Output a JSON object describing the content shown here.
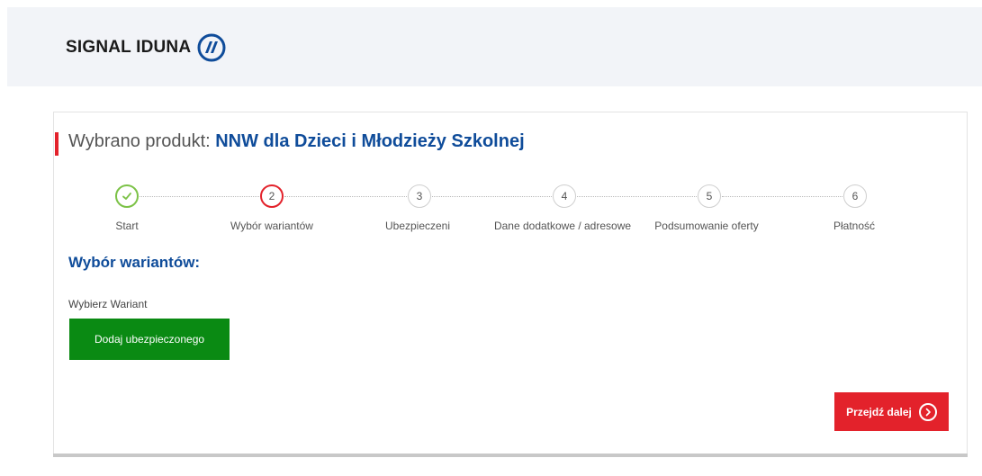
{
  "header": {
    "logo_text": "SIGNAL IDUNA",
    "logo_icon": "signal-iduna-logo-mark",
    "brand_color": "#0f4c9a"
  },
  "title": {
    "prefix": "Wybrano produkt: ",
    "product": "NNW dla Dzieci i Młodzieży Szkolnej",
    "accent_color": "#e3222b"
  },
  "steps": [
    {
      "number": "",
      "label": "Start",
      "state": "done",
      "icon": "check-icon"
    },
    {
      "number": "2",
      "label": "Wybór wariantów",
      "state": "active"
    },
    {
      "number": "3",
      "label": "Ubezpieczeni",
      "state": "pending"
    },
    {
      "number": "4",
      "label": "Dane dodatkowe / adresowe",
      "state": "pending"
    },
    {
      "number": "5",
      "label": "Podsumowanie oferty",
      "state": "pending"
    },
    {
      "number": "6",
      "label": "Płatność",
      "state": "pending"
    }
  ],
  "section": {
    "title": "Wybór wariantów:",
    "field_label": "Wybierz Wariant",
    "add_button": "Dodaj ubezpieczonego",
    "add_button_color": "#0a8a13"
  },
  "footer": {
    "next_button": "Przejdź dalej",
    "next_icon": "chevron-right-circle-icon",
    "next_button_color": "#e3222b"
  },
  "colors": {
    "done": "#7cc247",
    "active": "#e3222b",
    "header_bg": "#f2f4f8"
  }
}
